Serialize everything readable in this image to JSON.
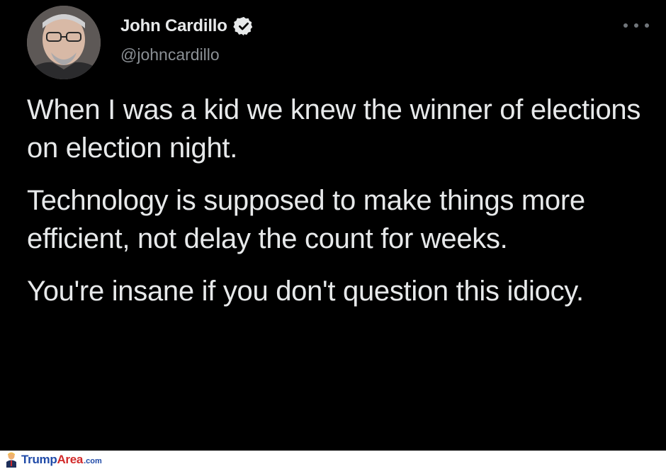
{
  "tweet": {
    "author": {
      "name": "John Cardillo",
      "handle": "@johncardillo",
      "verified": true,
      "avatar_icon": "profile-photo"
    },
    "menu_icon": "more-options-icon",
    "paragraphs": [
      "When I was a kid we knew the winner of elections on election night.",
      "Technology is supposed to make things more efficient, not delay the count for weeks.",
      "You're insane if you don't question this idiocy."
    ]
  },
  "watermark": {
    "part1": "Trump",
    "part2": "Area",
    "part3": ".com",
    "colors": {
      "blue": "#1f4aa8",
      "red": "#d22a2a"
    }
  },
  "colors": {
    "background": "#000000",
    "text": "#e7e9ea",
    "secondary": "#8b9095",
    "verified_badge": "#e7e9ea"
  }
}
